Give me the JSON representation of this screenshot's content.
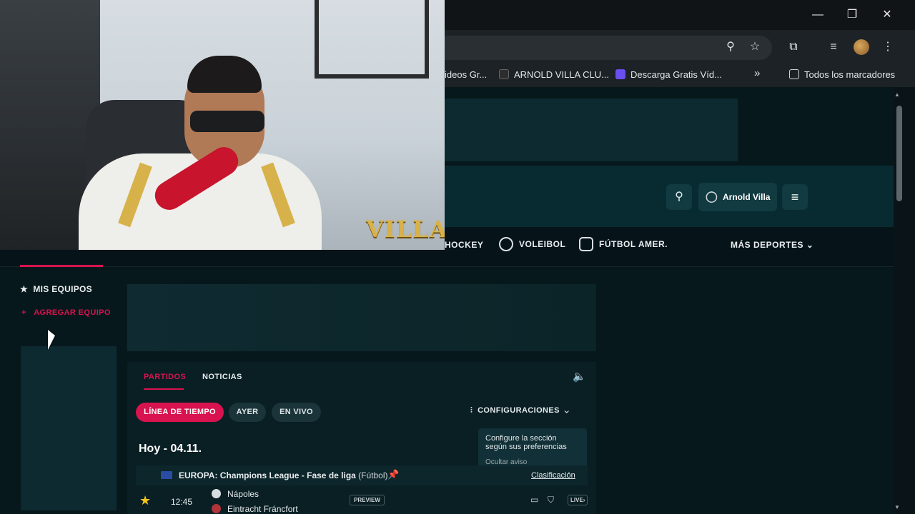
{
  "window": {
    "minimize": "—",
    "restore": "❐",
    "close": "✕"
  },
  "toolbar": {
    "zoom_icon": "⚲",
    "star_icon": "☆",
    "extensions_icon": "⧉",
    "media_icon": "≡",
    "menu_icon": "⋮"
  },
  "bookmarks": {
    "items": [
      {
        "label": "ideos Gr...",
        "color": "#f2f2f2"
      },
      {
        "label": "ARNOLD VILLA CLU...",
        "color": "#2d2d2d"
      },
      {
        "label": "Descarga Gratis Víd...",
        "color": "#6b4ef0"
      }
    ],
    "more": "»",
    "all_label": "Todos los marcadores"
  },
  "header": {
    "user_name": "Arnold Villa"
  },
  "sports_nav": {
    "items": [
      "HOCKEY",
      "VOLEIBOL",
      "FÚTBOL AMER."
    ],
    "more": "MÁS DEPORTES"
  },
  "sidebar": {
    "my_teams": "MIS EQUIPOS",
    "add_team": "AGREGAR EQUIPO"
  },
  "panel": {
    "tabs": [
      "PARTIDOS",
      "NOTICIAS"
    ],
    "filters": [
      "LÍNEA DE TIEMPO",
      "AYER",
      "EN VIVO"
    ],
    "config_label": "CONFIGURACIONES",
    "tooltip_text": "Configure la sección según sus preferencias",
    "tooltip_hide": "Ocultar aviso",
    "date_heading": "Hoy - 04.11.",
    "league": {
      "name": "EUROPA: Champions League - Fase de liga",
      "sport": "(Fútbol)",
      "standings": "Clasificación"
    },
    "match": {
      "time": "12:45",
      "home": "Nápoles",
      "away": "Eintracht Fráncfort",
      "preview": "PREVIEW",
      "live": "LIVE›"
    }
  },
  "webcam": {
    "logo_text": "VILLA"
  },
  "colors": {
    "accent": "#d8134f",
    "panel_bg": "#091f24",
    "page_bg": "#07181c"
  }
}
